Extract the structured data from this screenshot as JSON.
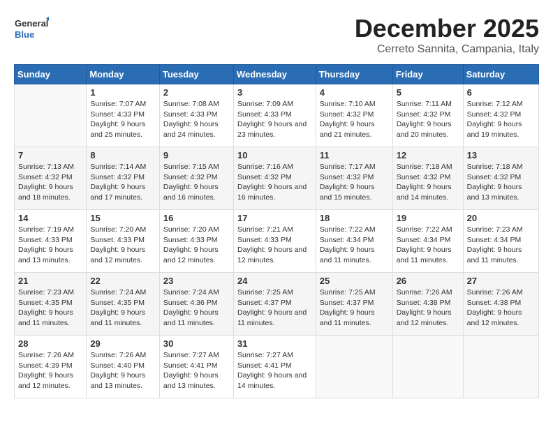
{
  "logo": {
    "line1": "General",
    "line2": "Blue"
  },
  "title": "December 2025",
  "location": "Cerreto Sannita, Campania, Italy",
  "days_of_week": [
    "Sunday",
    "Monday",
    "Tuesday",
    "Wednesday",
    "Thursday",
    "Friday",
    "Saturday"
  ],
  "weeks": [
    [
      {
        "day": "",
        "sunrise": "",
        "sunset": "",
        "daylight": ""
      },
      {
        "day": "1",
        "sunrise": "Sunrise: 7:07 AM",
        "sunset": "Sunset: 4:33 PM",
        "daylight": "Daylight: 9 hours and 25 minutes."
      },
      {
        "day": "2",
        "sunrise": "Sunrise: 7:08 AM",
        "sunset": "Sunset: 4:33 PM",
        "daylight": "Daylight: 9 hours and 24 minutes."
      },
      {
        "day": "3",
        "sunrise": "Sunrise: 7:09 AM",
        "sunset": "Sunset: 4:33 PM",
        "daylight": "Daylight: 9 hours and 23 minutes."
      },
      {
        "day": "4",
        "sunrise": "Sunrise: 7:10 AM",
        "sunset": "Sunset: 4:32 PM",
        "daylight": "Daylight: 9 hours and 21 minutes."
      },
      {
        "day": "5",
        "sunrise": "Sunrise: 7:11 AM",
        "sunset": "Sunset: 4:32 PM",
        "daylight": "Daylight: 9 hours and 20 minutes."
      },
      {
        "day": "6",
        "sunrise": "Sunrise: 7:12 AM",
        "sunset": "Sunset: 4:32 PM",
        "daylight": "Daylight: 9 hours and 19 minutes."
      }
    ],
    [
      {
        "day": "7",
        "sunrise": "Sunrise: 7:13 AM",
        "sunset": "Sunset: 4:32 PM",
        "daylight": "Daylight: 9 hours and 18 minutes."
      },
      {
        "day": "8",
        "sunrise": "Sunrise: 7:14 AM",
        "sunset": "Sunset: 4:32 PM",
        "daylight": "Daylight: 9 hours and 17 minutes."
      },
      {
        "day": "9",
        "sunrise": "Sunrise: 7:15 AM",
        "sunset": "Sunset: 4:32 PM",
        "daylight": "Daylight: 9 hours and 16 minutes."
      },
      {
        "day": "10",
        "sunrise": "Sunrise: 7:16 AM",
        "sunset": "Sunset: 4:32 PM",
        "daylight": "Daylight: 9 hours and 16 minutes."
      },
      {
        "day": "11",
        "sunrise": "Sunrise: 7:17 AM",
        "sunset": "Sunset: 4:32 PM",
        "daylight": "Daylight: 9 hours and 15 minutes."
      },
      {
        "day": "12",
        "sunrise": "Sunrise: 7:18 AM",
        "sunset": "Sunset: 4:32 PM",
        "daylight": "Daylight: 9 hours and 14 minutes."
      },
      {
        "day": "13",
        "sunrise": "Sunrise: 7:18 AM",
        "sunset": "Sunset: 4:32 PM",
        "daylight": "Daylight: 9 hours and 13 minutes."
      }
    ],
    [
      {
        "day": "14",
        "sunrise": "Sunrise: 7:19 AM",
        "sunset": "Sunset: 4:33 PM",
        "daylight": "Daylight: 9 hours and 13 minutes."
      },
      {
        "day": "15",
        "sunrise": "Sunrise: 7:20 AM",
        "sunset": "Sunset: 4:33 PM",
        "daylight": "Daylight: 9 hours and 12 minutes."
      },
      {
        "day": "16",
        "sunrise": "Sunrise: 7:20 AM",
        "sunset": "Sunset: 4:33 PM",
        "daylight": "Daylight: 9 hours and 12 minutes."
      },
      {
        "day": "17",
        "sunrise": "Sunrise: 7:21 AM",
        "sunset": "Sunset: 4:33 PM",
        "daylight": "Daylight: 9 hours and 12 minutes."
      },
      {
        "day": "18",
        "sunrise": "Sunrise: 7:22 AM",
        "sunset": "Sunset: 4:34 PM",
        "daylight": "Daylight: 9 hours and 11 minutes."
      },
      {
        "day": "19",
        "sunrise": "Sunrise: 7:22 AM",
        "sunset": "Sunset: 4:34 PM",
        "daylight": "Daylight: 9 hours and 11 minutes."
      },
      {
        "day": "20",
        "sunrise": "Sunrise: 7:23 AM",
        "sunset": "Sunset: 4:34 PM",
        "daylight": "Daylight: 9 hours and 11 minutes."
      }
    ],
    [
      {
        "day": "21",
        "sunrise": "Sunrise: 7:23 AM",
        "sunset": "Sunset: 4:35 PM",
        "daylight": "Daylight: 9 hours and 11 minutes."
      },
      {
        "day": "22",
        "sunrise": "Sunrise: 7:24 AM",
        "sunset": "Sunset: 4:35 PM",
        "daylight": "Daylight: 9 hours and 11 minutes."
      },
      {
        "day": "23",
        "sunrise": "Sunrise: 7:24 AM",
        "sunset": "Sunset: 4:36 PM",
        "daylight": "Daylight: 9 hours and 11 minutes."
      },
      {
        "day": "24",
        "sunrise": "Sunrise: 7:25 AM",
        "sunset": "Sunset: 4:37 PM",
        "daylight": "Daylight: 9 hours and 11 minutes."
      },
      {
        "day": "25",
        "sunrise": "Sunrise: 7:25 AM",
        "sunset": "Sunset: 4:37 PM",
        "daylight": "Daylight: 9 hours and 11 minutes."
      },
      {
        "day": "26",
        "sunrise": "Sunrise: 7:26 AM",
        "sunset": "Sunset: 4:38 PM",
        "daylight": "Daylight: 9 hours and 12 minutes."
      },
      {
        "day": "27",
        "sunrise": "Sunrise: 7:26 AM",
        "sunset": "Sunset: 4:38 PM",
        "daylight": "Daylight: 9 hours and 12 minutes."
      }
    ],
    [
      {
        "day": "28",
        "sunrise": "Sunrise: 7:26 AM",
        "sunset": "Sunset: 4:39 PM",
        "daylight": "Daylight: 9 hours and 12 minutes."
      },
      {
        "day": "29",
        "sunrise": "Sunrise: 7:26 AM",
        "sunset": "Sunset: 4:40 PM",
        "daylight": "Daylight: 9 hours and 13 minutes."
      },
      {
        "day": "30",
        "sunrise": "Sunrise: 7:27 AM",
        "sunset": "Sunset: 4:41 PM",
        "daylight": "Daylight: 9 hours and 13 minutes."
      },
      {
        "day": "31",
        "sunrise": "Sunrise: 7:27 AM",
        "sunset": "Sunset: 4:41 PM",
        "daylight": "Daylight: 9 hours and 14 minutes."
      },
      {
        "day": "",
        "sunrise": "",
        "sunset": "",
        "daylight": ""
      },
      {
        "day": "",
        "sunrise": "",
        "sunset": "",
        "daylight": ""
      },
      {
        "day": "",
        "sunrise": "",
        "sunset": "",
        "daylight": ""
      }
    ]
  ]
}
